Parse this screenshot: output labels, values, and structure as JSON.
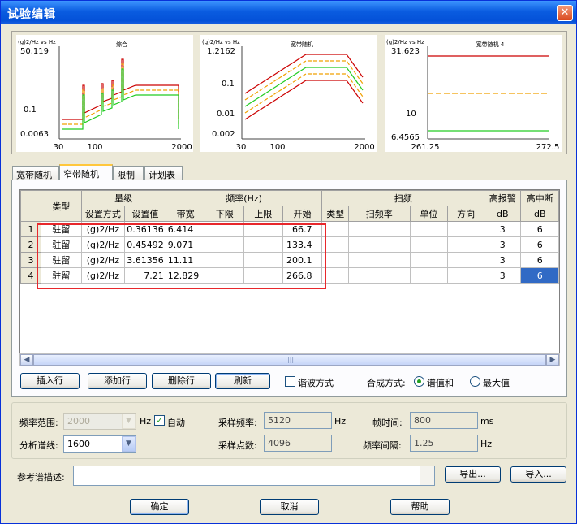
{
  "window": {
    "title": "试验编辑",
    "close_icon": "close-icon"
  },
  "charts": [
    {
      "ylabel": "(g)2/Hz vs Hz",
      "title": "综合",
      "y_ticks": [
        "50.119",
        "0.1",
        "0.0063"
      ],
      "x_ticks": [
        "30",
        "100",
        "2000"
      ]
    },
    {
      "ylabel": "(g)2/Hz vs Hz",
      "title": "宽带随机",
      "y_ticks": [
        "1.2162",
        "0.1",
        "0.01",
        "0.002"
      ],
      "x_ticks": [
        "30",
        "100",
        "2000"
      ]
    },
    {
      "ylabel": "(g)2/Hz vs Hz",
      "title": "宽带随机 4",
      "y_ticks": [
        "31.623",
        "10",
        "6.4565"
      ],
      "x_ticks": [
        "261.25",
        "272.5"
      ]
    }
  ],
  "tabs": [
    "宽带随机",
    "窄带随机",
    "限制",
    "计划表"
  ],
  "active_tab": 1,
  "grid": {
    "group_headers": [
      "类型",
      "量级",
      "频率(Hz)",
      "扫频",
      "高报警",
      "高中断"
    ],
    "sub_headers": [
      "设置方式",
      "设置值",
      "带宽",
      "下限",
      "上限",
      "开始",
      "类型",
      "扫频率",
      "单位",
      "方向",
      "dB",
      "dB"
    ],
    "rows": [
      {
        "no": "1",
        "type": "驻留",
        "mode": "(g)2/Hz",
        "value": "0.36136",
        "bw": "6.414",
        "low": "",
        "high": "",
        "start": "66.7",
        "stype": "",
        "srate": "",
        "unit": "",
        "dir": "",
        "alarm": "3",
        "abort": "6"
      },
      {
        "no": "2",
        "type": "驻留",
        "mode": "(g)2/Hz",
        "value": "0.45492",
        "bw": "9.071",
        "low": "",
        "high": "",
        "start": "133.4",
        "stype": "",
        "srate": "",
        "unit": "",
        "dir": "",
        "alarm": "3",
        "abort": "6"
      },
      {
        "no": "3",
        "type": "驻留",
        "mode": "(g)2/Hz",
        "value": "3.61356",
        "bw": "11.11",
        "low": "",
        "high": "",
        "start": "200.1",
        "stype": "",
        "srate": "",
        "unit": "",
        "dir": "",
        "alarm": "3",
        "abort": "6"
      },
      {
        "no": "4",
        "type": "驻留",
        "mode": "(g)2/Hz",
        "value": "7.21",
        "bw": "12.829",
        "low": "",
        "high": "",
        "start": "266.8",
        "stype": "",
        "srate": "",
        "unit": "",
        "dir": "",
        "alarm": "3",
        "abort": "6"
      }
    ]
  },
  "scrollbar": {
    "left_icon": "arrow-left-icon",
    "right_icon": "arrow-right-icon",
    "grip": "|||"
  },
  "row_buttons": {
    "insert": "插入行",
    "add": "添加行",
    "delete": "删除行",
    "refresh": "刷新"
  },
  "harmonic": {
    "label": "谐波方式",
    "checked": false
  },
  "synthesis": {
    "label": "合成方式:",
    "options": [
      "谱值和",
      "最大值"
    ],
    "selected": 0
  },
  "settings": {
    "freq_range_label": "频率范围:",
    "freq_range_value": "2000",
    "freq_unit": "Hz",
    "auto_label": "自动",
    "auto_checked": true,
    "sample_rate_label": "采样频率:",
    "sample_rate_value": "5120",
    "sample_rate_unit": "Hz",
    "frame_time_label": "帧时间:",
    "frame_time_value": "800",
    "frame_time_unit": "ms",
    "lines_label": "分析谱线:",
    "lines_value": "1600",
    "points_label": "采样点数:",
    "points_value": "4096",
    "freq_interval_label": "频率间隔:",
    "freq_interval_value": "1.25",
    "freq_interval_unit": "Hz"
  },
  "reference": {
    "label": "参考谱描述:",
    "export": "导出...",
    "import": "导入..."
  },
  "footer": {
    "ok": "确定",
    "cancel": "取消",
    "help": "帮助"
  },
  "colors": {
    "abort_line": "#cc0000",
    "alarm_line": "#f0a000",
    "profile_line": "#22cc22",
    "selection": "#316ac5",
    "highlight_box": "#e8282c"
  }
}
